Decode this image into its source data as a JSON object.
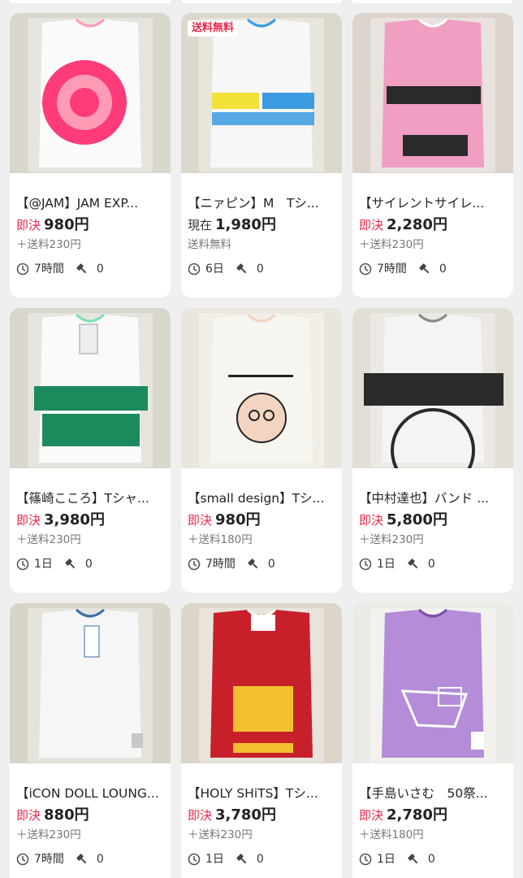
{
  "listings": [
    {
      "title": "【@JAM】JAM EXP...",
      "price_kind": "即決",
      "price": "980円",
      "shipping": "＋送料230円",
      "time": "7時間",
      "bids": "0",
      "tag": "",
      "colors": {
        "bg": "#d9d6cc",
        "shirt": "#fafafa",
        "print": "#ff3b7a",
        "accent": "#ff9bb5"
      }
    },
    {
      "title": "【ニァピン】M　Tシ...",
      "price_kind": "現在",
      "price": "1,980円",
      "shipping": "送料無料",
      "time": "6日",
      "bids": "0",
      "tag": "送料無料",
      "colors": {
        "bg": "#dcd7cb",
        "shirt": "#f7f7f7",
        "print": "#f2e23a",
        "accent": "#3b9be0"
      }
    },
    {
      "title": "【サイレントサイレ...",
      "price_kind": "即決",
      "price": "2,280円",
      "shipping": "＋送料230円",
      "time": "7時間",
      "bids": "0",
      "tag": "",
      "colors": {
        "bg": "#dcd4cc",
        "shirt": "#f09ec2",
        "print": "#2a2a2a",
        "accent": "#ffffff"
      }
    },
    {
      "title": "【篠崎こころ】Tシャ...",
      "price_kind": "即決",
      "price": "3,980円",
      "shipping": "＋送料230円",
      "time": "1日",
      "bids": "0",
      "tag": "",
      "colors": {
        "bg": "#d9d6cc",
        "shirt": "#fafafa",
        "print": "#1c8a5c",
        "accent": "#7fe0b0"
      }
    },
    {
      "title": "【small design】Tシ...",
      "price_kind": "即決",
      "price": "980円",
      "shipping": "＋送料180円",
      "time": "7時間",
      "bids": "0",
      "tag": "",
      "colors": {
        "bg": "#ebe6dc",
        "shirt": "#f7f5f0",
        "print": "#222222",
        "accent": "#f2d4c0"
      }
    },
    {
      "title": "【中村達也】バンド ...",
      "price_kind": "即決",
      "price": "5,800円",
      "shipping": "＋送料230円",
      "time": "1日",
      "bids": "0",
      "tag": "",
      "colors": {
        "bg": "#e2ded6",
        "shirt": "#f4f4f4",
        "print": "#2a2a2a",
        "accent": "#8a8a8a"
      }
    },
    {
      "title": "【iCON DOLL LOUNG...",
      "price_kind": "即決",
      "price": "880円",
      "shipping": "＋送料230円",
      "time": "7時間",
      "bids": "0",
      "tag": "",
      "colors": {
        "bg": "#d8d4c8",
        "shirt": "#f6f6f6",
        "print": "#c8c8c8",
        "accent": "#3a6ea8"
      }
    },
    {
      "title": "【HOLY SHiTS】Tシ...",
      "price_kind": "即決",
      "price": "3,780円",
      "shipping": "＋送料230円",
      "time": "1日",
      "bids": "0",
      "tag": "",
      "colors": {
        "bg": "#dcd6c8",
        "shirt": "#c8202a",
        "print": "#f2c030",
        "accent": "#ffffff"
      }
    },
    {
      "title": "【手島いさむ　50祭...",
      "price_kind": "即決",
      "price": "2,780円",
      "shipping": "＋送料180円",
      "time": "1日",
      "bids": "0",
      "tag": "",
      "colors": {
        "bg": "#eceae4",
        "shirt": "#b48cd8",
        "print": "#ffffff",
        "accent": "#7a52a8"
      }
    }
  ],
  "icons": {
    "time": "clock-icon",
    "bids": "gavel-icon"
  },
  "accent_color": "#e8284a"
}
